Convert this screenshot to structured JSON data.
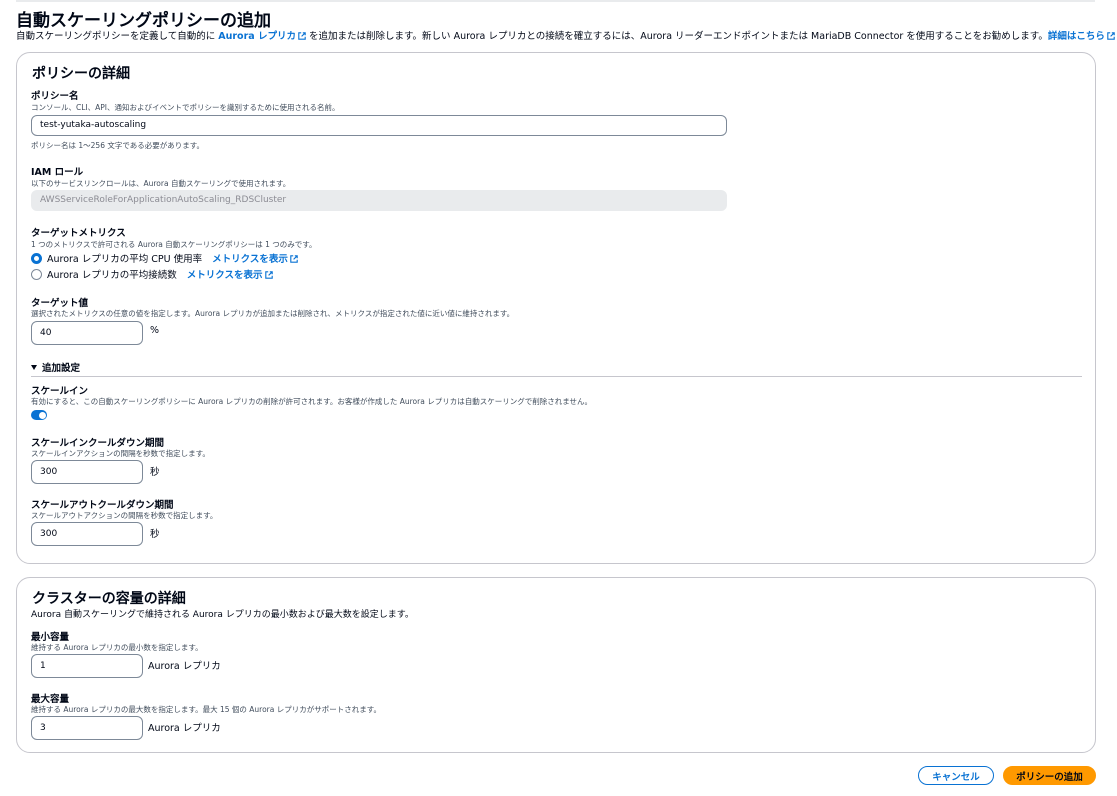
{
  "page": {
    "title": "自動スケーリングポリシーの追加",
    "desc_pre": "自動スケーリングポリシーを定義して自動的に ",
    "desc_link1": "Aurora レプリカ",
    "desc_mid": " を追加または削除します。新しい Aurora レプリカとの接続を確立するには、Aurora リーダーエンドポイントまたは MariaDB Connector を使用することをお勧めします。",
    "desc_link2": "詳細はこちら"
  },
  "policy": {
    "heading": "ポリシーの詳細",
    "name_label": "ポリシー名",
    "name_hint": "コンソール、CLI、API、通知およびイベントでポリシーを識別するために使用される名前。",
    "name_value": "test-yutaka-autoscaling",
    "name_constraint": "ポリシー名は 1〜256 文字である必要があります。",
    "iam_label": "IAM ロール",
    "iam_hint": "以下のサービスリンクロールは、Aurora 自動スケーリングで使用されます。",
    "iam_value": "AWSServiceRoleForApplicationAutoScaling_RDSCluster",
    "metric_label": "ターゲットメトリクス",
    "metric_hint": "1 つのメトリクスで許可される Aurora 自動スケーリングポリシーは 1 つのみです。",
    "metric_options": [
      {
        "label": "Aurora レプリカの平均 CPU 使用率",
        "link": "メトリクスを表示",
        "checked": true
      },
      {
        "label": "Aurora レプリカの平均接続数",
        "link": "メトリクスを表示",
        "checked": false
      }
    ],
    "target_label": "ターゲット値",
    "target_hint": "選択されたメトリクスの任意の値を指定します。Aurora レプリカが追加または削除され、メトリクスが指定された値に近い値に維持されます。",
    "target_value": "40",
    "target_unit": "%",
    "additional_label": "追加設定",
    "scalein_label": "スケールイン",
    "scalein_hint": "有効にすると、この自動スケーリングポリシーに Aurora レプリカの削除が許可されます。お客様が作成した Aurora レプリカは自動スケーリングで削除されません。",
    "scalein_enabled": true,
    "scalein_cooldown_label": "スケールインクールダウン期間",
    "scalein_cooldown_hint": "スケールインアクションの間隔を秒数で指定します。",
    "scalein_cooldown_value": "300",
    "scalein_cooldown_unit": "秒",
    "scaleout_cooldown_label": "スケールアウトクールダウン期間",
    "scaleout_cooldown_hint": "スケールアウトアクションの間隔を秒数で指定します。",
    "scaleout_cooldown_value": "300",
    "scaleout_cooldown_unit": "秒"
  },
  "capacity": {
    "heading": "クラスターの容量の詳細",
    "desc": "Aurora 自動スケーリングで維持される Aurora レプリカの最小数および最大数を設定します。",
    "min_label": "最小容量",
    "min_hint": "維持する Aurora レプリカの最小数を指定します。",
    "min_value": "1",
    "min_unit": "Aurora レプリカ",
    "max_label": "最大容量",
    "max_hint": "維持する Aurora レプリカの最大数を指定します。最大 15 個の Aurora レプリカがサポートされます。",
    "max_value": "3",
    "max_unit": "Aurora レプリカ"
  },
  "actions": {
    "cancel": "キャンセル",
    "add": "ポリシーの追加"
  },
  "colors": {
    "link": "#0972d3",
    "primary_button": "#ff9900",
    "border": "#c6c6cd"
  }
}
